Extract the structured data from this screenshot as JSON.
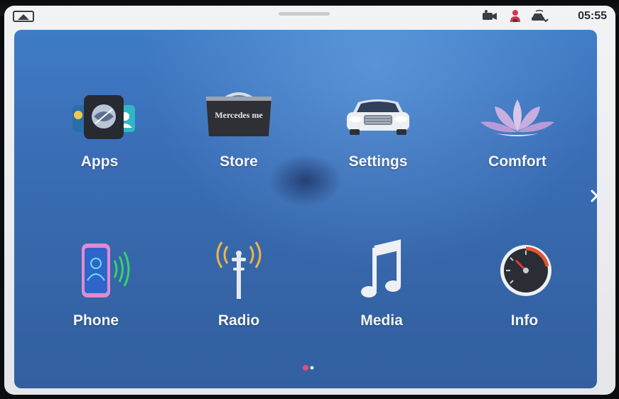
{
  "status_bar": {
    "time": "05:55",
    "icons": [
      "camera-icon",
      "user-profile-icon",
      "car-signal-icon"
    ],
    "left_icon": "screen-cast-icon"
  },
  "home": {
    "page": 1,
    "page_count": 2,
    "tiles": [
      {
        "id": "apps",
        "label": "Apps",
        "icon": "apps-icon"
      },
      {
        "id": "store",
        "label": "Store",
        "icon": "store-bag-icon",
        "icon_text": "Mercedes me"
      },
      {
        "id": "settings",
        "label": "Settings",
        "icon": "car-front-icon"
      },
      {
        "id": "comfort",
        "label": "Comfort",
        "icon": "lotus-icon"
      },
      {
        "id": "phone",
        "label": "Phone",
        "icon": "phone-icon"
      },
      {
        "id": "radio",
        "label": "Radio",
        "icon": "radio-antenna-icon"
      },
      {
        "id": "media",
        "label": "Media",
        "icon": "music-note-icon"
      },
      {
        "id": "info",
        "label": "Info",
        "icon": "gauge-icon"
      }
    ]
  },
  "colors": {
    "panel_blue": "#3a6db6",
    "label_white": "#f4f6fa",
    "status_red": "#d8334a",
    "pager_active": "#e0507a"
  }
}
